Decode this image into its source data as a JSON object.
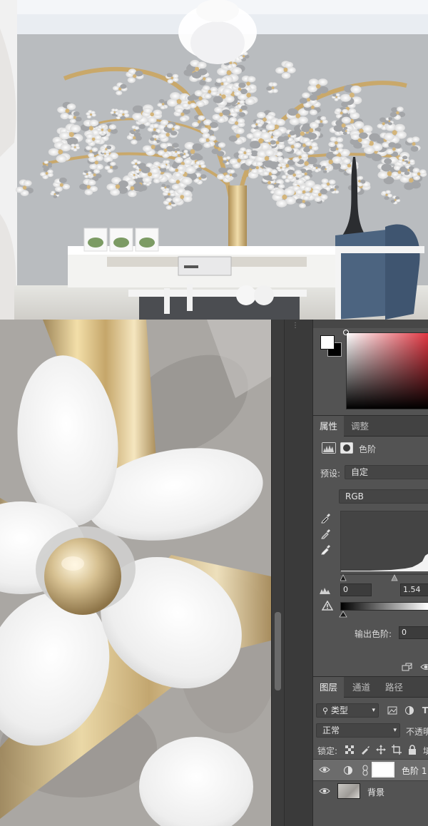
{
  "app": "Photoshop",
  "colors": {
    "panel_bg": "#535353",
    "panel_dark": "#424242",
    "selected_row": "#6c6c6c",
    "picker_hue": "#e0303c",
    "gold": "#c9a86a",
    "wall": "#b9bcbf"
  },
  "properties_panel": {
    "tabs": [
      {
        "label": "属性",
        "active": true
      },
      {
        "label": "调整",
        "active": false
      }
    ],
    "adjustment_title": "色阶",
    "preset_label": "预设:",
    "preset_value": "自定",
    "channel_value": "RGB",
    "input_black": "0",
    "input_gamma": "1.54",
    "output_levels_label": "输出色阶:",
    "output_black": "0",
    "icons": [
      "levels-icon",
      "mask-icon",
      "eyedropper-black-icon",
      "eyedropper-gray-icon",
      "eyedropper-white-icon",
      "auto-icon",
      "warning-icon",
      "clip-to-layer-icon",
      "visibility-icon"
    ]
  },
  "layers_panel": {
    "tabs": [
      {
        "label": "图层",
        "active": true
      },
      {
        "label": "通道",
        "active": false
      },
      {
        "label": "路径",
        "active": false
      }
    ],
    "filter_label": "类型",
    "blend_mode": "正常",
    "opacity_label": "不透明",
    "lock_label": "锁定:",
    "fill_label": "填",
    "layers": [
      {
        "name": "色阶 1",
        "selected": true,
        "type": "adjustment"
      },
      {
        "name": "背景",
        "selected": false,
        "type": "image"
      }
    ]
  }
}
